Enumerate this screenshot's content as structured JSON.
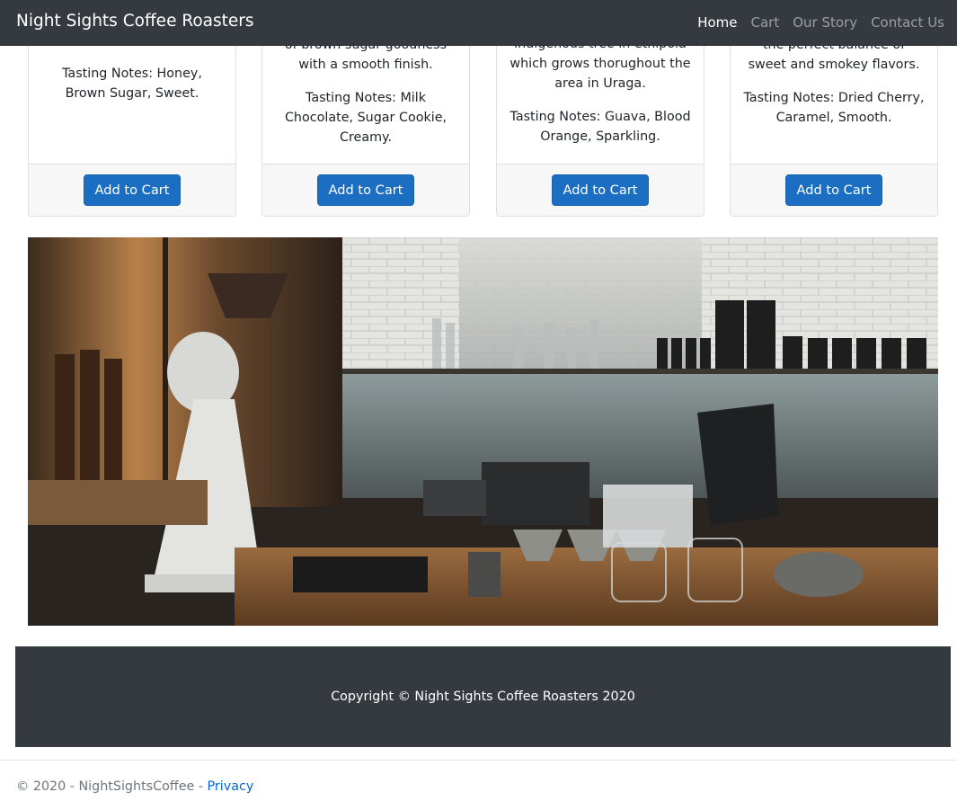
{
  "navbar": {
    "brand": "Night Sights Coffee Roasters",
    "links": [
      {
        "label": "Home",
        "active": true
      },
      {
        "label": "Cart",
        "active": false
      },
      {
        "label": "Our Story",
        "active": false
      },
      {
        "label": "Contact Us",
        "active": false
      }
    ]
  },
  "products": [
    {
      "description_tail": "",
      "tasting_notes": "Tasting Notes: Honey, Brown Sugar, Sweet.",
      "button_label": "Add to Cart"
    },
    {
      "description_tail": "of brown sugar goodness with a smooth finish.",
      "tasting_notes": "Tasting Notes: Milk Chocolate, Sugar Cookie, Creamy.",
      "button_label": "Add to Cart"
    },
    {
      "description_tail": "indigenous tree in ethipoia which grows thorughout the area in Uraga.",
      "tasting_notes": "Tasting Notes: Guava, Blood Orange, Sparkling.",
      "button_label": "Add to Cart"
    },
    {
      "description_tail": "the perfect balance of sweet and smokey flavors.",
      "tasting_notes": "Tasting Notes: Dried Cherry, Caramel, Smooth.",
      "button_label": "Add to Cart"
    }
  ],
  "hero_image": {
    "alt": "coffee bar"
  },
  "footer": {
    "copyright": "Copyright © Night Sights Coffee Roasters 2020"
  },
  "bottom_footer": {
    "text": "© 2020 - NightSightsCoffee - ",
    "privacy_link": "Privacy"
  },
  "colors": {
    "navbar_bg": "#343a40",
    "button_bg": "#1b6ec2",
    "link": "#0366d6"
  }
}
